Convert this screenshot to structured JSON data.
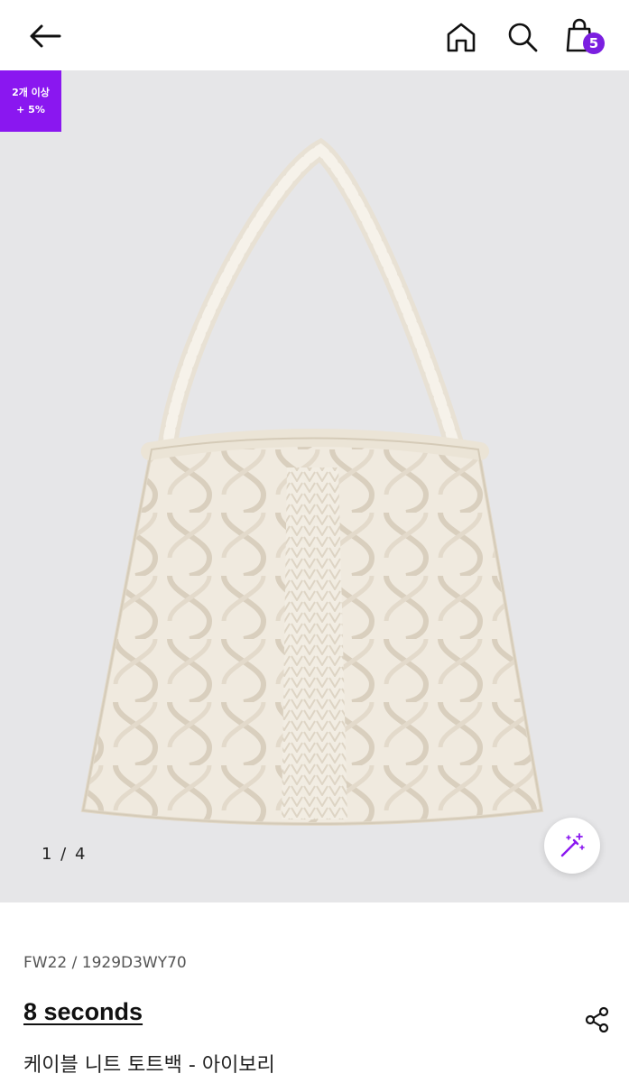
{
  "header": {
    "back_icon": "arrow-left-icon",
    "home_icon": "home-icon",
    "search_icon": "search-icon",
    "cart_icon": "shopping-bag-icon",
    "cart_count": "5",
    "accent_color": "#7b1fe0"
  },
  "promo_badge": {
    "line1": "2개 이상",
    "line2": "+ 5%",
    "color": "#8a17f0"
  },
  "gallery": {
    "counter": "1 / 4",
    "current": 1,
    "total": 4,
    "magic_icon": "magic-wand-icon"
  },
  "product": {
    "sku": "FW22 / 1929D3WY70",
    "brand": "8 seconds",
    "name": "케이블 니트 토트백 - 아이보리",
    "share_icon": "share-icon"
  }
}
